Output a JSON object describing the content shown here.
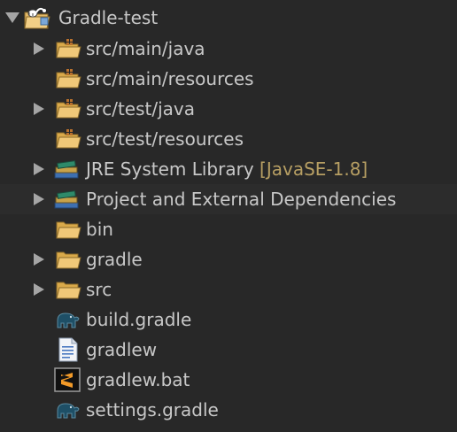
{
  "project": {
    "name": "Gradle-test",
    "expanded": true
  },
  "items": [
    {
      "label": "src/main/java",
      "icon": "package-folder-icon",
      "expandable": true
    },
    {
      "label": "src/main/resources",
      "icon": "package-folder-icon",
      "expandable": false
    },
    {
      "label": "src/test/java",
      "icon": "package-folder-icon",
      "expandable": true
    },
    {
      "label": "src/test/resources",
      "icon": "package-folder-icon",
      "expandable": false
    },
    {
      "label": "JRE System Library",
      "decoration": "[JavaSE-1.8]",
      "icon": "library-icon",
      "expandable": true
    },
    {
      "label": "Project and External Dependencies",
      "icon": "library-icon",
      "expandable": true
    },
    {
      "label": "bin",
      "icon": "folder-icon",
      "expandable": false
    },
    {
      "label": "gradle",
      "icon": "folder-icon",
      "expandable": true
    },
    {
      "label": "src",
      "icon": "folder-icon",
      "expandable": true
    },
    {
      "label": "build.gradle",
      "icon": "gradle-elephant-icon",
      "expandable": false
    },
    {
      "label": "gradlew",
      "icon": "text-file-icon",
      "expandable": false
    },
    {
      "label": "gradlew.bat",
      "icon": "sublime-file-icon",
      "expandable": false
    },
    {
      "label": "settings.gradle",
      "icon": "gradle-elephant-icon",
      "expandable": false
    }
  ],
  "colors": {
    "background": "#282828",
    "text": "#c8c8c8",
    "decoration": "#b79f63",
    "twisty": "#a5a5a5",
    "folder": "#e2b867"
  }
}
